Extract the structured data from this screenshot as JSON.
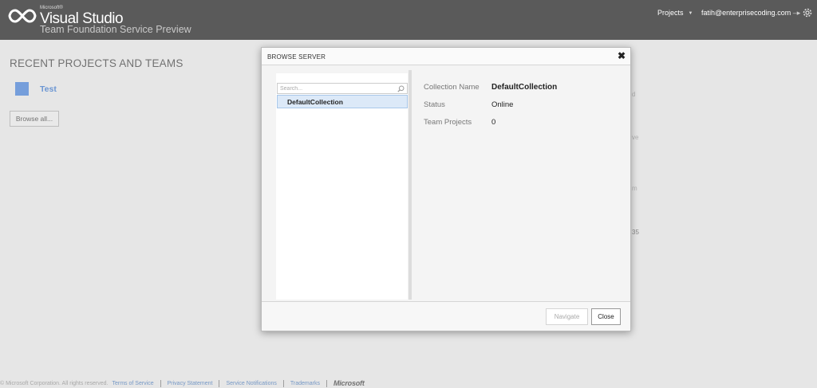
{
  "header": {
    "brand_small": "Microsoft®",
    "brand": "Visual Studio",
    "subtitle": "Team Foundation Service Preview",
    "projects_label": "Projects",
    "user_label": "fatih@enterprisecoding.com"
  },
  "page": {
    "recent_title": "RECENT PROJECTS AND TEAMS",
    "project_name": "Test",
    "browse_all_label": "Browse all...",
    "peek_fragments": [
      "d",
      "ve",
      "m",
      "35"
    ]
  },
  "dialog": {
    "title": "BROWSE SERVER",
    "search_placeholder": "Search...",
    "tree_items": [
      "DefaultCollection"
    ],
    "details": [
      {
        "label": "Collection Name",
        "value": "DefaultCollection"
      },
      {
        "label": "Status",
        "value": "Online"
      },
      {
        "label": "Team Projects",
        "value": "0"
      }
    ],
    "navigate_label": "Navigate",
    "close_label": "Close"
  },
  "footer": {
    "copyright": "© Microsoft Corporation. All rights reserved.",
    "links": [
      "Terms of Service",
      "Privacy Statement",
      "Service Notifications",
      "Trademarks"
    ],
    "logo_text": "Microsoft"
  },
  "colors": {
    "header_bg": "#5a5a5a",
    "accent": "#3a78d6",
    "selection": "#dce9f8"
  }
}
